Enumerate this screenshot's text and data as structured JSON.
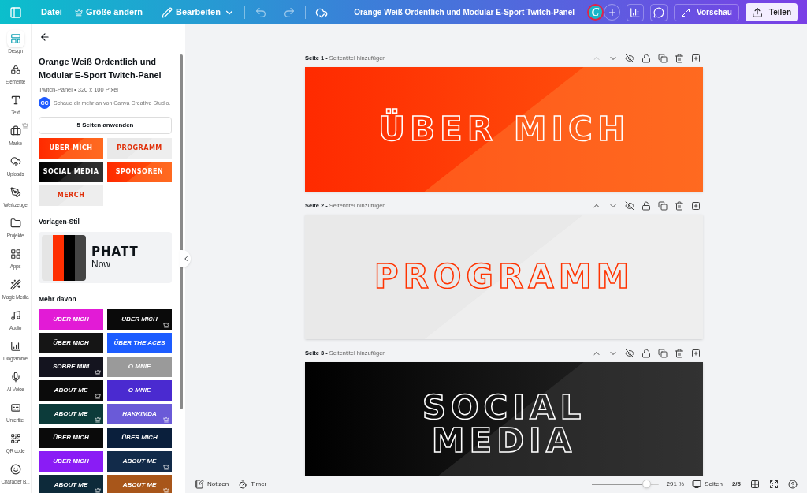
{
  "topbar": {
    "menu": [
      "Datei",
      "Größe ändern",
      "Bearbeiten"
    ],
    "title": "Orange Weiß Ordentlich und Modular E-Sport Twitch-Panel",
    "avatar": "C",
    "preview": "Vorschau",
    "share": "Teilen"
  },
  "rail": [
    {
      "label": "Design",
      "selected": true,
      "premium": false
    },
    {
      "label": "Elemente",
      "selected": false,
      "premium": false
    },
    {
      "label": "Text",
      "selected": false,
      "premium": false
    },
    {
      "label": "Marke",
      "selected": false,
      "premium": true
    },
    {
      "label": "Uploads",
      "selected": false,
      "premium": false
    },
    {
      "label": "Werkzeuge",
      "selected": false,
      "premium": false
    },
    {
      "label": "Projekte",
      "selected": false,
      "premium": false
    },
    {
      "label": "Apps",
      "selected": false,
      "premium": false
    },
    {
      "label": "Magic Media",
      "selected": false,
      "premium": false
    },
    {
      "label": "Audio",
      "selected": false,
      "premium": false
    },
    {
      "label": "Diagramme",
      "selected": false,
      "premium": false
    },
    {
      "label": "AI Voice",
      "selected": false,
      "premium": false
    },
    {
      "label": "Untertitel",
      "selected": false,
      "premium": false
    },
    {
      "label": "QR code",
      "selected": false,
      "premium": false
    },
    {
      "label": "Character B...",
      "selected": false,
      "premium": false
    }
  ],
  "panel": {
    "title": "Orange Weiß Ordentlich und Modular E-Sport Twitch-Panel",
    "meta": "Twitch-Panel • 320 x 100 Pixel",
    "creator_badge": "CC",
    "creator": "Schaue dir mehr an von Canva Creative Studio.",
    "apply": "5 Seiten anwenden",
    "page_thumbs": [
      {
        "label": "ÜBER MICH",
        "kind": "orange"
      },
      {
        "label": "PROGRAMM",
        "kind": "light"
      },
      {
        "label": "SOCIAL MEDIA",
        "kind": "dark"
      },
      {
        "label": "SPONSOREN",
        "kind": "orange"
      },
      {
        "label": "MERCH",
        "kind": "light"
      }
    ],
    "style_heading": "Vorlagen-Stil",
    "style": {
      "font": "PHATT",
      "subtitle": "Now"
    },
    "more_heading": "Mehr davon",
    "more": [
      {
        "label": "ÜBER MICH",
        "color": "#e21bd6",
        "premium": false
      },
      {
        "label": "ÜBER MICH",
        "color": "#0a0a0a",
        "premium": true
      },
      {
        "label": "ÜBER MICH",
        "color": "#151515",
        "premium": false
      },
      {
        "label": "ÜBER THE ACES",
        "color": "#1d5cff",
        "premium": false
      },
      {
        "label": "SOBRE MIM",
        "color": "#14141f",
        "premium": true
      },
      {
        "label": "O MNIE",
        "color": "#9a9a9a",
        "premium": false
      },
      {
        "label": "ABOUT ME",
        "color": "#0b0b0b",
        "premium": true
      },
      {
        "label": "O MNIE",
        "color": "#4a2ad0",
        "premium": false
      },
      {
        "label": "ABOUT ME",
        "color": "#0c3b3a",
        "premium": true
      },
      {
        "label": "HAKKIMDA",
        "color": "#6a5ad8",
        "premium": true
      },
      {
        "label": "ÜBER MICH",
        "color": "#0a0a0a",
        "premium": false
      },
      {
        "label": "ÜBER MICH",
        "color": "#0a1f3c",
        "premium": false
      },
      {
        "label": "ÜBER MICH",
        "color": "#8a1cf5",
        "premium": false
      },
      {
        "label": "ABOUT ME",
        "color": "#122b4a",
        "premium": true
      },
      {
        "label": "ABOUT ME",
        "color": "#0d2a3a",
        "premium": true
      },
      {
        "label": "ABOUT ME",
        "color": "#a8561a",
        "premium": true
      }
    ]
  },
  "pages": [
    {
      "label": "Seite 1 -",
      "title_placeholder": "Seitentitel hinzufügen",
      "text": "ÜBER MICH",
      "kind": "orange",
      "can_move_up": false
    },
    {
      "label": "Seite 2 -",
      "title_placeholder": "Seitentitel hinzufügen",
      "text": "PROGRAMM",
      "kind": "light",
      "can_move_up": true
    },
    {
      "label": "Seite 3 -",
      "title_placeholder": "Seitentitel hinzufügen",
      "text": "SOCIAL MEDIA",
      "kind": "dark",
      "can_move_up": true
    }
  ],
  "bottombar": {
    "notes": "Notizen",
    "timer": "Timer",
    "zoom": {
      "level": 0.82,
      "reading": "291 %"
    },
    "pages": "Seiten",
    "page_count": "2/5"
  }
}
